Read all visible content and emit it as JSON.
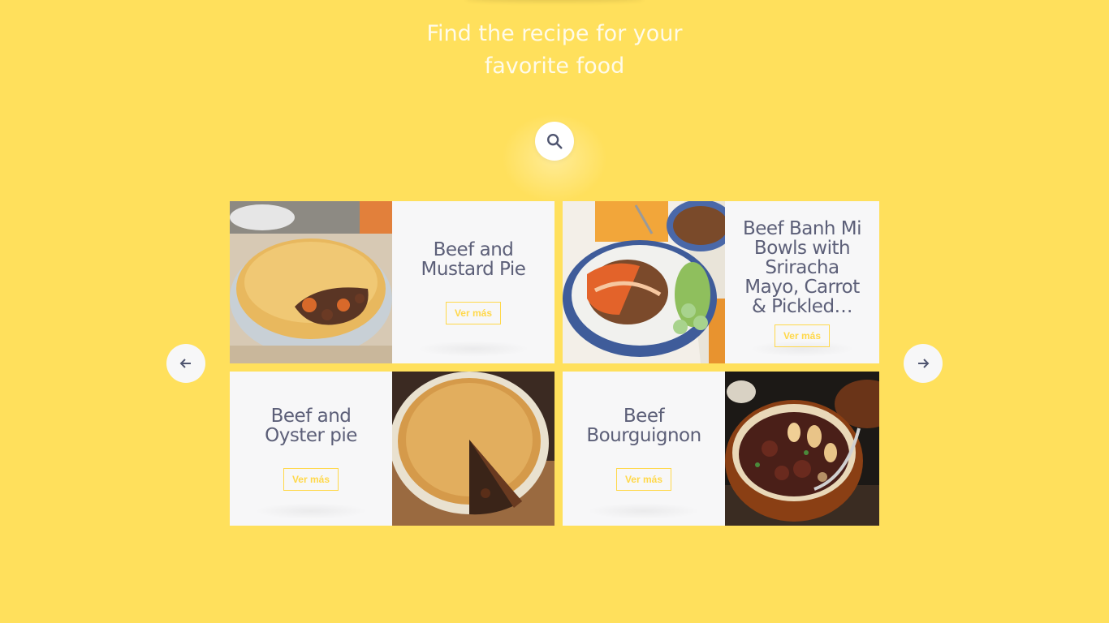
{
  "header": {
    "title_line1": "Find the recipe for your",
    "title_line2": "favorite food"
  },
  "search": {
    "icon": "search-icon"
  },
  "carousel": {
    "prev_icon": "arrow-left-icon",
    "next_icon": "arrow-right-icon",
    "cards": [
      {
        "title": "Beef and Mustard Pie",
        "button": "Ver más"
      },
      {
        "title": "Beef Banh Mi Bowls with Sriracha Mayo, Carrot & Pickled…",
        "button": "Ver más"
      },
      {
        "title": "Beef and Oyster pie",
        "button": "Ver más"
      },
      {
        "title": "Beef Bourguignon",
        "button": "Ver más"
      }
    ]
  },
  "colors": {
    "background": "#ffe05c",
    "accent": "#ffd84a",
    "title_text": "#5c5f78",
    "card_bg": "#f7f7f8"
  }
}
